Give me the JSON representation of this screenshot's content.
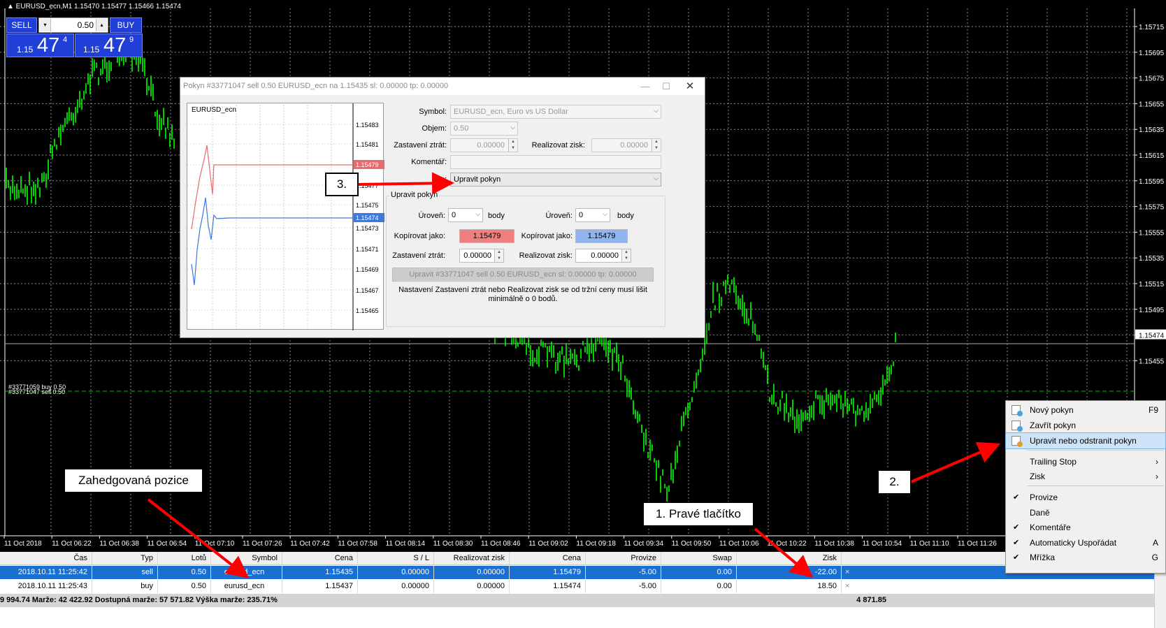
{
  "chart": {
    "header": "EURUSD_ecn,M1  1.15470 1.15477 1.15466 1.15474",
    "price_axis": [
      "1.15715",
      "1.15695",
      "1.15675",
      "1.15655",
      "1.15635",
      "1.15615",
      "1.15595",
      "1.15575",
      "1.15555",
      "1.15535",
      "1.15515",
      "1.15495",
      "1.15474",
      "1.15455"
    ],
    "time_axis": [
      "11 Oct 2018",
      "11 Oct 06:22",
      "11 Oct 06:38",
      "11 Oct 06:54",
      "11 Oct 07:10",
      "11 Oct 07:26",
      "11 Oct 07:42",
      "11 Oct 07:58",
      "11 Oct 08:14",
      "11 Oct 08:30",
      "11 Oct 08:46",
      "11 Oct 09:02",
      "11 Oct 09:18",
      "11 Oct 09:34",
      "11 Oct 09:50",
      "11 Oct 10:06",
      "11 Oct 10:22",
      "11 Oct 10:38",
      "11 Oct 10:54",
      "11 Oct 11:10",
      "11 Oct 11:26"
    ],
    "order_label_1": "#33771059 buy 0.50",
    "order_label_2": "#33771047 sell 0.50",
    "colors": {
      "background": "#000000",
      "grid": "#ffffff",
      "candles": "#00ff00",
      "order_line": "#00c000"
    }
  },
  "one_click": {
    "sell_label": "SELL",
    "buy_label": "BUY",
    "volume": "0.50",
    "sell_price_prefix": "1.15",
    "sell_price_big": "47",
    "sell_price_small": "4",
    "buy_price_prefix": "1.15",
    "buy_price_big": "47",
    "buy_price_small": "9"
  },
  "dialog": {
    "title": "Pokyn #33771047 sell 0.50 EURUSD_ecn na 1.15435 sl: 0.00000 tp: 0.00000",
    "mini_chart": {
      "symbol": "EURUSD_ecn",
      "axis": [
        "1.15483",
        "1.15481",
        "1.15479",
        "1.15477",
        "1.15475",
        "1.15474",
        "1.15473",
        "1.15471",
        "1.15469",
        "1.15467",
        "1.15465"
      ],
      "ask_tag": "1.15479",
      "bid_tag": "1.15474"
    },
    "symbol_label": "Symbol:",
    "symbol_value": "EURUSD_ecn, Euro vs US Dollar",
    "volume_label": "Objem:",
    "volume_value": "0.50",
    "sl_label": "Zastavení ztrát:",
    "sl_value": "0.00000",
    "tp_label": "Realizovat zisk:",
    "tp_value": "0.00000",
    "comment_label": "Komentář:",
    "comment_value": "",
    "type_label": "Typ:",
    "type_value": "Upravit pokyn",
    "group_label": "Upravit pokyn",
    "level_label": "Úroveň:",
    "level_sl_value": "0",
    "level_tp_value": "0",
    "points_label": "body",
    "copy_label": "Kopírovat jako:",
    "copy_sl_value": "1.15479",
    "copy_tp_value": "1.15479",
    "sl2_value": "0.00000",
    "tp2_value": "0.00000",
    "modify_button": "Upravit #33771047 sell 0.50 EURUSD_ecn sl: 0.00000 tp: 0.00000",
    "note": "Nastavení Zastavení ztrát nebo Realizovat zisk se od tržní ceny musí lišit minimálně o 0 bodů.",
    "colors": {
      "copy_sl": "#f08080",
      "copy_tp": "#8fb4f0"
    }
  },
  "context_menu": {
    "items": [
      {
        "label": "Nový pokyn",
        "key": "F9"
      },
      {
        "label": "Zavřít pokyn",
        "key": ""
      },
      {
        "label": "Upravit nebo odstranit pokyn",
        "key": ""
      },
      {
        "label": "Trailing Stop",
        "key": "›"
      },
      {
        "label": "Zisk",
        "key": "›"
      },
      {
        "label": "Provize",
        "key": ""
      },
      {
        "label": "Daně",
        "key": ""
      },
      {
        "label": "Komentáře",
        "key": ""
      },
      {
        "label": "Automaticky Uspořádat",
        "key": "A"
      },
      {
        "label": "Mřížka",
        "key": "G"
      }
    ]
  },
  "terminal": {
    "columns": [
      "Čas",
      "Typ",
      "Lotů",
      "Symbol",
      "Cena",
      "S / L",
      "Realizovat zisk",
      "Cena",
      "Provize",
      "Swap",
      "Zisk"
    ],
    "rows": [
      [
        "2018.10.11 11:25:42",
        "sell",
        "0.50",
        "eurusd_ecn",
        "1.15435",
        "0.00000",
        "0.00000",
        "1.15479",
        "-5.00",
        "0.00",
        "-22.00"
      ],
      [
        "2018.10.11 11:25:43",
        "buy",
        "0.50",
        "eurusd_ecn",
        "1.15437",
        "0.00000",
        "0.00000",
        "1.15474",
        "-5.00",
        "0.00",
        "18.50"
      ]
    ],
    "summary": "9 994.74  Marže: 42 422.92  Dostupná marže: 57 571.82  Výška marže: 235.71%",
    "total": "4 871.85",
    "close_glyph": "×"
  },
  "callouts": {
    "c1": "1. Pravé tlačítko",
    "c2": "2.",
    "c3": "3.",
    "hedged": "Zahedgovaná pozice"
  }
}
